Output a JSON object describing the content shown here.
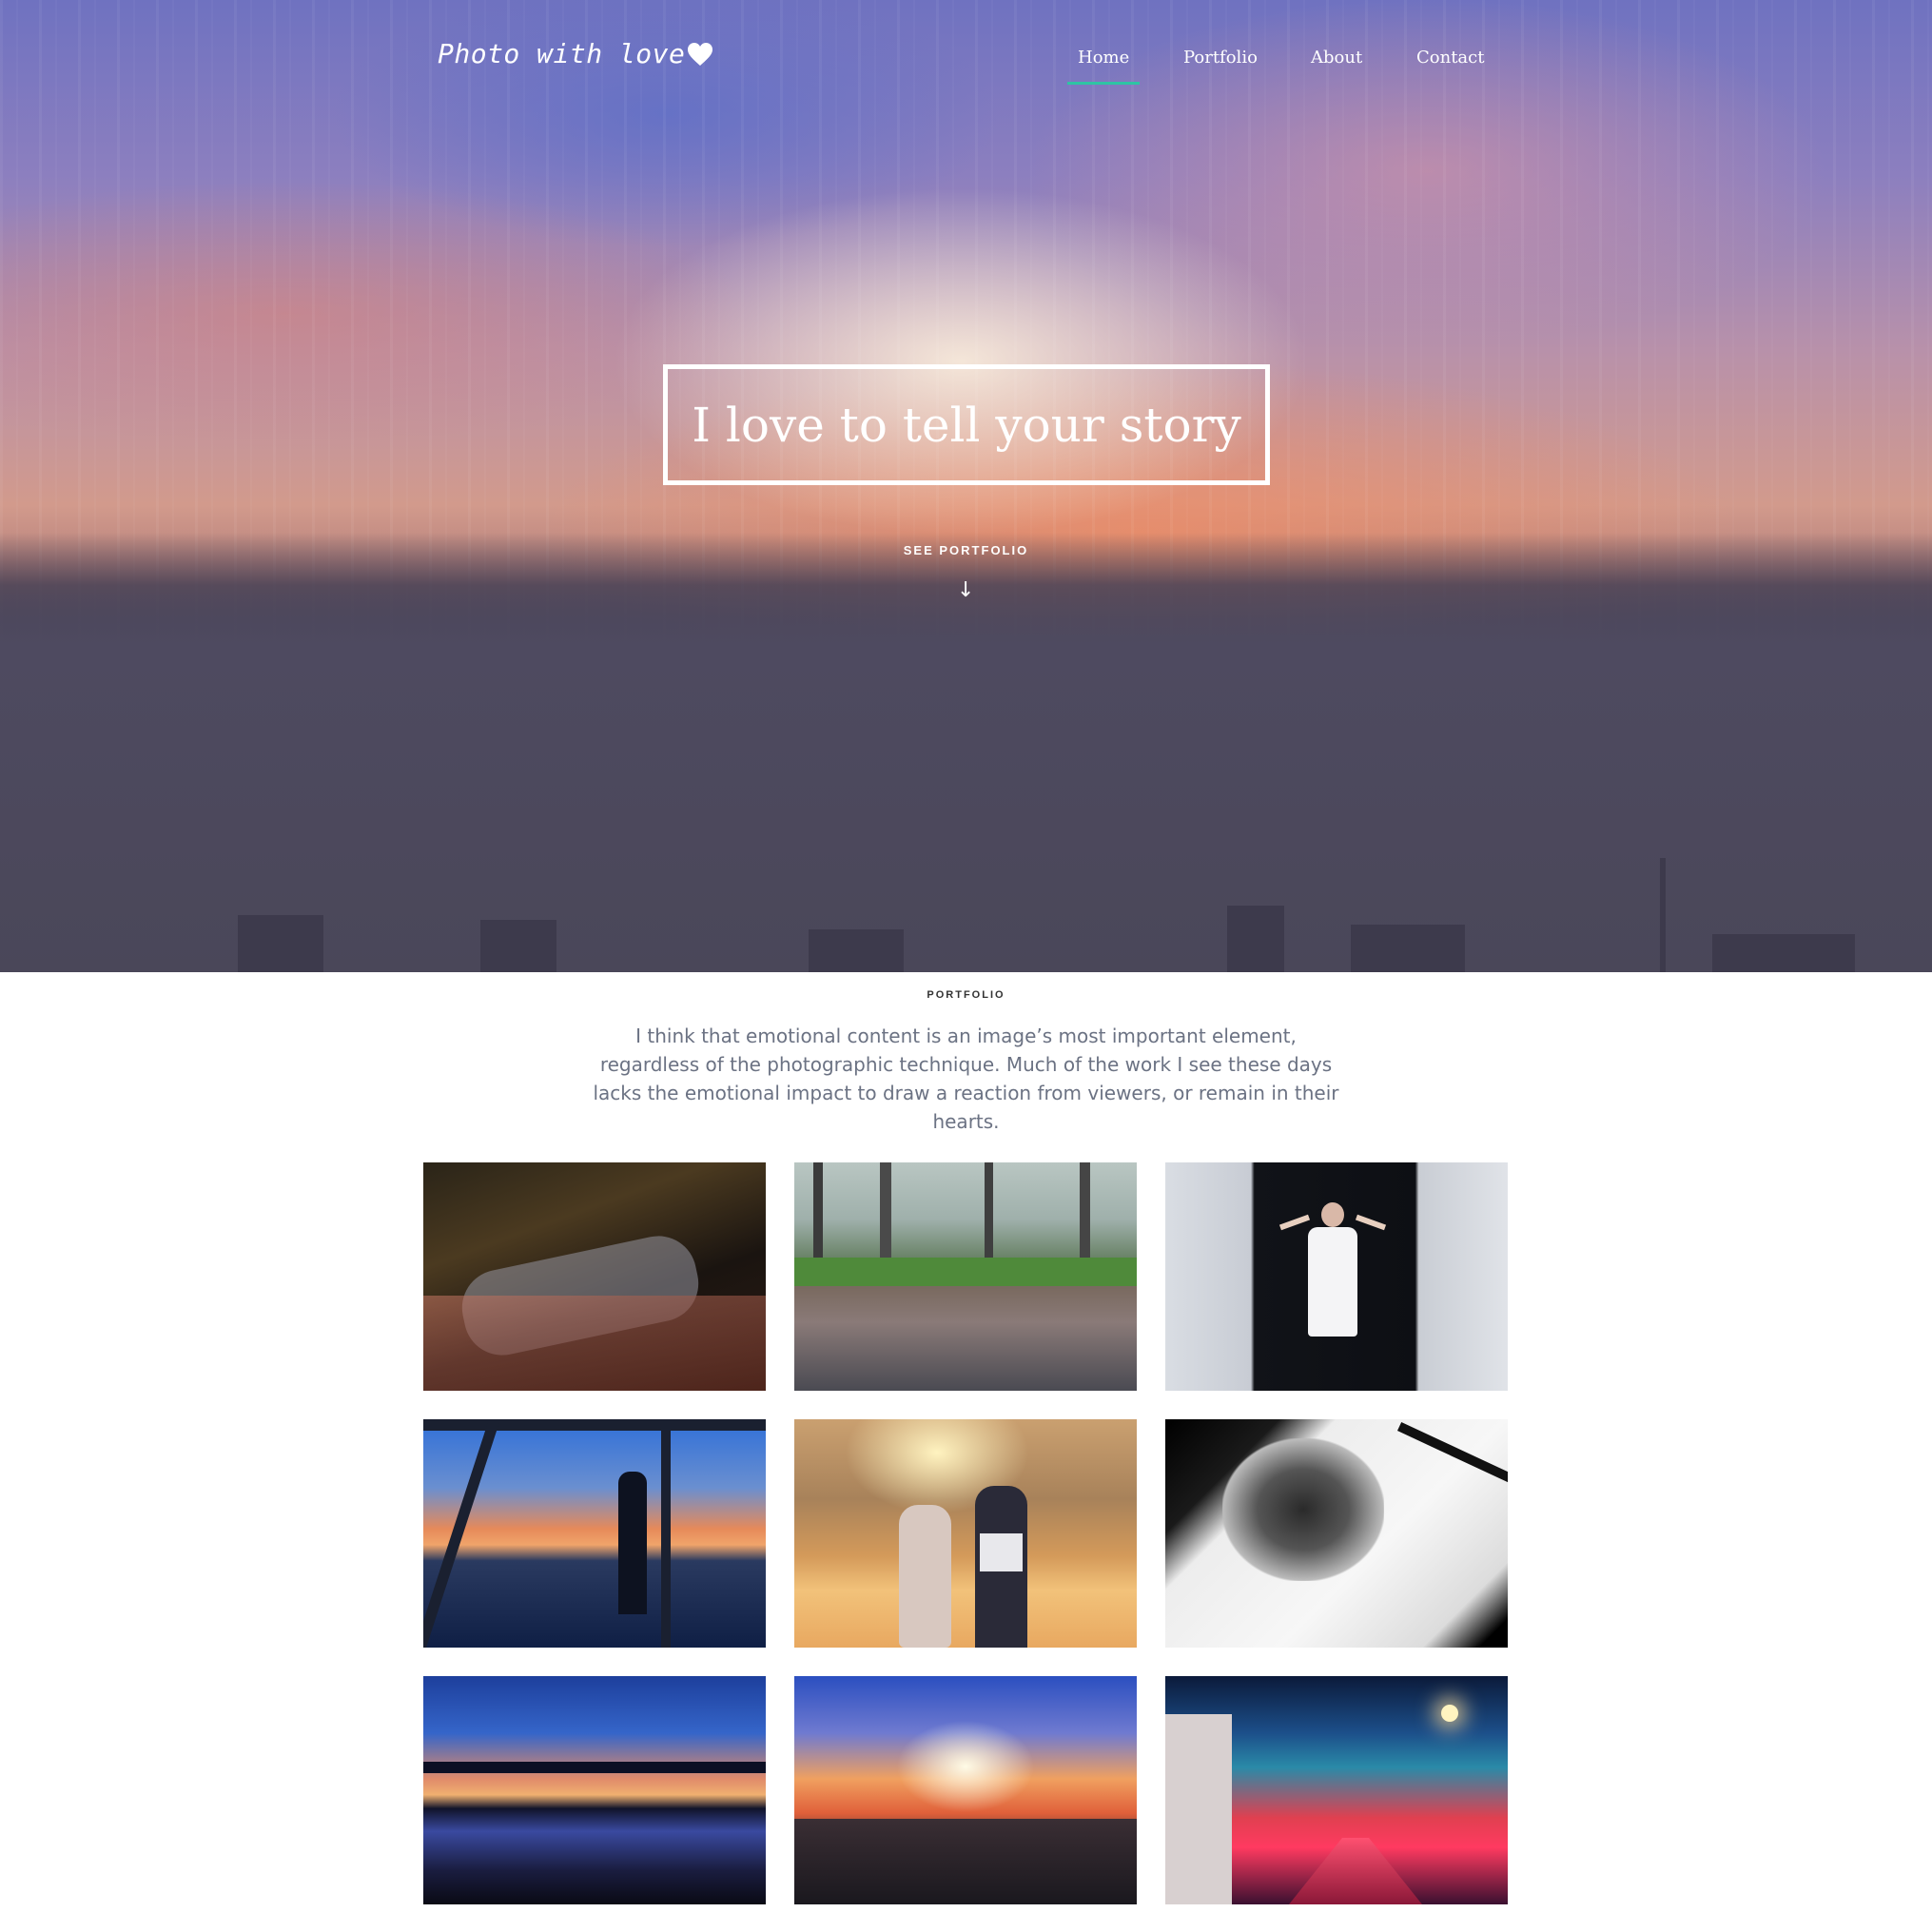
{
  "header": {
    "logo_text": "Photo with love",
    "nav": [
      {
        "label": "Home",
        "active": true
      },
      {
        "label": "Portfolio",
        "active": false
      },
      {
        "label": "About",
        "active": false
      },
      {
        "label": "Contact",
        "active": false
      }
    ],
    "accent_color": "#2ec4a4"
  },
  "hero": {
    "headline": "I love to tell your story",
    "cta_label": "SEE PORTFOLIO",
    "cta_icon": "arrow-down-icon"
  },
  "portfolio": {
    "section_label": "PORTFOLIO",
    "intro": "I think that emotional content is an image’s most important element, regardless of the photographic technique. Much of the work I see these days lacks the emotional impact to draw a reaction from viewers, or remain in their hearts.",
    "photos": [
      {
        "name": "man-lying-on-blanket-photo"
      },
      {
        "name": "forest-puddle-photo"
      },
      {
        "name": "woman-in-doorway-photo"
      },
      {
        "name": "silhouette-on-bridge-photo"
      },
      {
        "name": "couple-at-sunset-photo"
      },
      {
        "name": "wolf-drawing-photo"
      },
      {
        "name": "lake-sunset-photo"
      },
      {
        "name": "city-sunset-photo"
      },
      {
        "name": "railway-at-night-photo"
      }
    ]
  }
}
